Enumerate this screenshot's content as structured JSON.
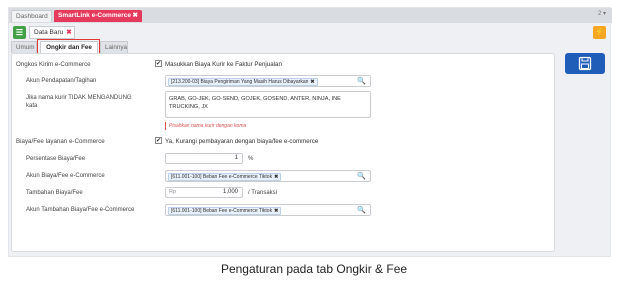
{
  "topbar": {
    "tabs": [
      {
        "label": "Dashboard"
      },
      {
        "label": "SmartLink e-Commerce",
        "close": "✖"
      }
    ],
    "more": "2 ▾"
  },
  "toolbar": {
    "menu_glyph": "☰",
    "doc_tab_label": "Data Baru",
    "doc_tab_close": "✖",
    "orange_glyph": "⚡"
  },
  "subtabs": {
    "umum": "Umum",
    "ongkir": "Ongkir dan Fee",
    "lainnya": "Lainnya"
  },
  "form": {
    "ongkos_section": "Ongkos Kirim e-Commerce",
    "ongkos_checkbox_label": "Masukkan Biaya Kurir ke Faktur Penjualan",
    "akun_pendapatan_label": "Akun Pendapatan/Tagihan",
    "akun_pendapatan_value": "[213.200-03] Biaya Pengiriman Yang Masih Harus Dibayarkan",
    "kurir_label_line1": "Jika nama kurir TIDAK MENGANDUNG",
    "kurir_label_line2": "kata",
    "kurir_value_line1": "GRAB, GO-JEK, GO-SEND, GOJEK, GOSEND, ANTER, NINJA, INE",
    "kurir_value_line2": "TRUCKING, JX",
    "kurir_hint": "Pisahkan nama kurir dengan koma",
    "fee_section": "Biaya/Fee layanan e-Commerce",
    "fee_checkbox_label": "Ya, Kurangi pembayaran dengan biaya/fee e-commerce",
    "persentase_label": "Persentase Biaya/Fee",
    "persentase_value": "1",
    "persentase_unit": "%",
    "akun_biaya_label": "Akun Biaya/Fee e-Commerce",
    "akun_biaya_value": "[611.001-100] Beban Fee e-Commerce Tiktok",
    "tambahan_label": "Tambahan Biaya/Fee",
    "tambahan_prefix": "Rp",
    "tambahan_value": "1,000",
    "tambahan_unit": "/ Transaksi",
    "akun_tambahan_label": "Akun Tambahan Biaya/Fee e-Commerce",
    "akun_tambahan_value": "[611.001-100] Beban Fee e-Commerce Tiktok",
    "chip_close": "✖",
    "check_glyph": "✔",
    "search_glyph": "🔍"
  },
  "caption": "Pengaturan pada tab Ongkir & Fee",
  "colors": {
    "accent_pink": "#e53a5b",
    "save_blue": "#1f5db8",
    "green": "#43a047",
    "orange": "#f5a623",
    "highlight_red": "#e53935"
  }
}
